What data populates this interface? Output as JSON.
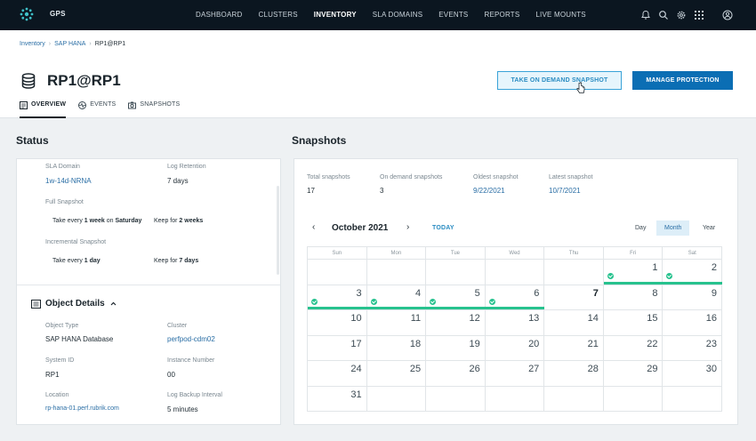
{
  "nav": {
    "brand": "GPS",
    "items": [
      "DASHBOARD",
      "CLUSTERS",
      "INVENTORY",
      "SLA DOMAINS",
      "EVENTS",
      "REPORTS",
      "LIVE MOUNTS"
    ],
    "active": "INVENTORY",
    "icons": [
      "bell-icon",
      "search-icon",
      "gear-icon",
      "apps-grid-icon",
      "user-icon"
    ]
  },
  "breadcrumb": [
    "Inventory",
    "SAP HANA",
    "RP1@RP1"
  ],
  "page": {
    "title": "RP1@RP1",
    "take_snapshot_label": "TAKE ON DEMAND SNAPSHOT",
    "manage_label": "MANAGE PROTECTION"
  },
  "tabs": [
    {
      "label": "OVERVIEW",
      "icon": "overview-icon"
    },
    {
      "label": "EVENTS",
      "icon": "events-icon"
    },
    {
      "label": "SNAPSHOTS",
      "icon": "camera-icon"
    }
  ],
  "status": {
    "title": "Status",
    "sla_domain_label": "SLA Domain",
    "sla_domain_value": "1w-14d-NRNA",
    "log_retention_label": "Log Retention",
    "log_retention_value": "7 days",
    "full_snapshot_label": "Full Snapshot",
    "full_take_pre": "Take every ",
    "full_take_freq": "1 week",
    "full_take_mid": " on ",
    "full_take_day": "Saturday",
    "full_keep_pre": "Keep for ",
    "full_keep_val": "2 weeks",
    "incr_snapshot_label": "Incremental Snapshot",
    "incr_take_pre": "Take every ",
    "incr_take_freq": "1 day",
    "incr_keep_pre": "Keep for ",
    "incr_keep_val": "7 days"
  },
  "object_details": {
    "title": "Object Details",
    "object_type_label": "Object Type",
    "object_type_value": "SAP HANA Database",
    "cluster_label": "Cluster",
    "cluster_value": "perfpod-cdm02",
    "system_id_label": "System ID",
    "system_id_value": "RP1",
    "instance_number_label": "Instance Number",
    "instance_number_value": "00",
    "location_label": "Location",
    "location_value": "rp-hana-01.perf.rubrik.com",
    "log_backup_label": "Log Backup Interval",
    "log_backup_value": "5 minutes"
  },
  "snapshots": {
    "title": "Snapshots",
    "total_label": "Total snapshots",
    "total_value": "17",
    "on_demand_label": "On demand snapshots",
    "on_demand_value": "3",
    "oldest_label": "Oldest snapshot",
    "oldest_value": "9/22/2021",
    "latest_label": "Latest snapshot",
    "latest_value": "10/7/2021"
  },
  "calendar": {
    "month_label": "October 2021",
    "today_label": "TODAY",
    "views": [
      "Day",
      "Month",
      "Year"
    ],
    "active_view": "Month",
    "weekdays": [
      "Sun",
      "Mon",
      "Tue",
      "Wed",
      "Thu",
      "Fri",
      "Sat"
    ],
    "weeks": [
      [
        "",
        "",
        "",
        "",
        "",
        "1",
        "2"
      ],
      [
        "3",
        "4",
        "5",
        "6",
        "7",
        "8",
        "9"
      ],
      [
        "10",
        "11",
        "12",
        "13",
        "14",
        "15",
        "16"
      ],
      [
        "17",
        "18",
        "19",
        "20",
        "21",
        "22",
        "23"
      ],
      [
        "24",
        "25",
        "26",
        "27",
        "28",
        "29",
        "30"
      ],
      [
        "31",
        "",
        "",
        "",
        "",
        "",
        ""
      ]
    ],
    "snapshot_days": [
      "1",
      "2",
      "3",
      "4",
      "5",
      "6"
    ],
    "highlight_day": "7",
    "colors": {
      "snapshot": "#27c28e",
      "accent": "#0b6eb4"
    }
  }
}
